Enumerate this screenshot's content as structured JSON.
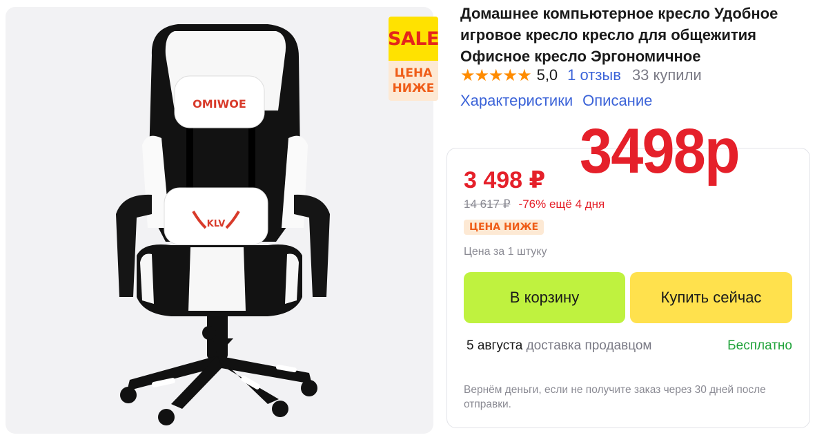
{
  "product": {
    "title": "Домашнее компьютерное кресло Удобное игровое кресло кресло для общежития Офисное кресло Эргономичное",
    "rating": "5,0",
    "stars": "★★★★★",
    "reviews_link": "1 отзыв",
    "bought": "33 купили",
    "tabs": [
      "Характеристики",
      "Описание"
    ],
    "pillow_brand": "OMIWOE",
    "lumbar_logo": "KLV"
  },
  "badge": {
    "sale": "SALE",
    "line1": "ЦЕНА",
    "line2": "НИЖЕ"
  },
  "overlay_price": "3498р",
  "price": {
    "current": "3 498 ₽",
    "old": "14 617 ₽",
    "discount": "-76% ещё 4 дня",
    "lower_badge": "ЦЕНА НИЖЕ",
    "unit": "Цена за 1 штуку"
  },
  "actions": {
    "add_to_cart": "В корзину",
    "buy_now": "Купить сейчас"
  },
  "delivery": {
    "date": "5 августа",
    "by": "доставка продавцом",
    "cost": "Бесплатно"
  },
  "refund_note": "Вернём деньги, если не получите заказ через 30 дней после отправки.",
  "colors": {
    "price_red": "#e5202a",
    "link_blue": "#3b63d8",
    "star_orange": "#ff8c00",
    "cart_green": "#bff23f",
    "buy_yellow": "#ffe14d",
    "free_green": "#21a33b"
  }
}
